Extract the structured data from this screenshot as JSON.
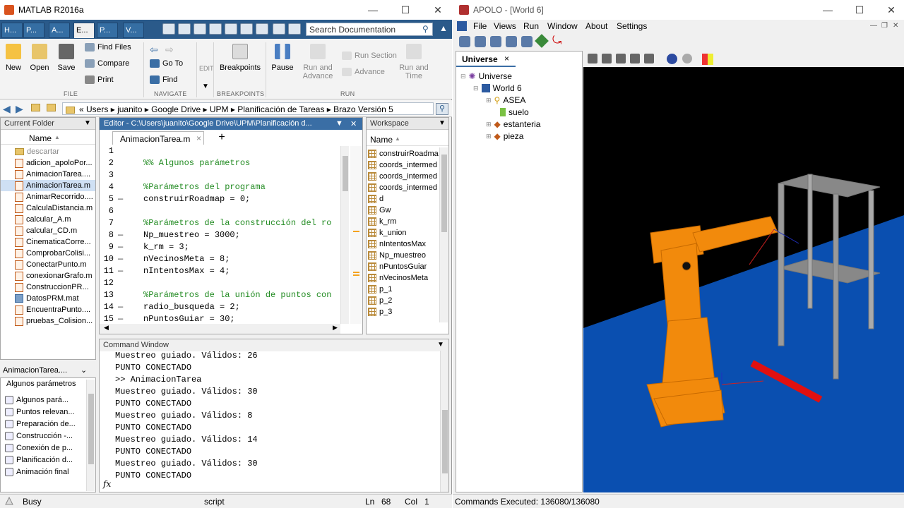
{
  "matlab": {
    "title": "MATLAB R2016a",
    "tabs": [
      "H...",
      "P...",
      "A...",
      "E...",
      "P...",
      "V..."
    ],
    "search_placeholder": "Search Documentation",
    "ribbon": {
      "file": {
        "new": "New",
        "open": "Open",
        "save": "Save",
        "find_files": "Find Files",
        "compare": "Compare",
        "print": "Print",
        "group": "FILE"
      },
      "navigate": {
        "go_to": "Go To",
        "find": "Find",
        "group": "NAVIGATE"
      },
      "edit": {
        "label": "EDIT"
      },
      "breakpoints": {
        "label": "Breakpoints",
        "group": "BREAKPOINTS"
      },
      "run": {
        "pause": "Pause",
        "run_and_advance": "Run and Advance",
        "run_section": "Run Section",
        "advance": "Advance",
        "run_and_time": "Run and Time",
        "group": "RUN"
      }
    },
    "path": [
      "Users",
      "juanito",
      "Google Drive",
      "UPM",
      "Planificación de Tareas",
      "Brazo Versión 5"
    ],
    "current_folder": {
      "title": "Current Folder",
      "col": "Name",
      "items": [
        {
          "name": "descartar",
          "type": "folder"
        },
        {
          "name": "adicion_apoloPor...",
          "type": "m"
        },
        {
          "name": "AnimacionTarea....",
          "type": "m"
        },
        {
          "name": "AnimacionTarea.m",
          "type": "m",
          "selected": true
        },
        {
          "name": "AnimarRecorrido....",
          "type": "m"
        },
        {
          "name": "CalculaDistancia.m",
          "type": "m"
        },
        {
          "name": "calcular_A.m",
          "type": "m"
        },
        {
          "name": "calcular_CD.m",
          "type": "m"
        },
        {
          "name": "CinematicaCorre...",
          "type": "m"
        },
        {
          "name": "ComprobarColisi...",
          "type": "m"
        },
        {
          "name": "ConectarPunto.m",
          "type": "m"
        },
        {
          "name": "conexionarGrafo.m",
          "type": "m"
        },
        {
          "name": "ConstruccionPR...",
          "type": "m"
        },
        {
          "name": "DatosPRM.mat",
          "type": "mat"
        },
        {
          "name": "EncuentraPunto....",
          "type": "m"
        },
        {
          "name": "pruebas_Colision...",
          "type": "m"
        }
      ]
    },
    "details_file": "AnimacionTarea....",
    "outline": {
      "header": "Algunos parámetros",
      "items": [
        "Algunos pará...",
        "Puntos relevan...",
        "Preparación de...",
        "Construcción -...",
        "Conexión de p...",
        "Planificación d...",
        "Animación final"
      ]
    },
    "editor": {
      "title": "Editor - C:\\Users\\juanito\\Google Drive\\UPM\\Planificación d...",
      "tab": "AnimacionTarea.m",
      "lines": [
        {
          "n": "1",
          "dash": "",
          "text": "",
          "cls": ""
        },
        {
          "n": "2",
          "dash": "",
          "text": "%% Algunos parámetros",
          "cls": "cm"
        },
        {
          "n": "3",
          "dash": "",
          "text": "",
          "cls": ""
        },
        {
          "n": "4",
          "dash": "",
          "text": "%Parámetros del programa",
          "cls": "cm"
        },
        {
          "n": "5",
          "dash": "—",
          "text": "construirRoadmap = 0;",
          "cls": ""
        },
        {
          "n": "6",
          "dash": "",
          "text": "",
          "cls": ""
        },
        {
          "n": "7",
          "dash": "",
          "text": "%Parámetros de la construcción del ro",
          "cls": "cm"
        },
        {
          "n": "8",
          "dash": "—",
          "text": "Np_muestreo = 3000;",
          "cls": ""
        },
        {
          "n": "9",
          "dash": "—",
          "text": "k_rm = 3;",
          "cls": ""
        },
        {
          "n": "10",
          "dash": "—",
          "text": "nVecinosMeta = 8;",
          "cls": ""
        },
        {
          "n": "11",
          "dash": "—",
          "text": "nIntentosMax = 4;",
          "cls": ""
        },
        {
          "n": "12",
          "dash": "",
          "text": "",
          "cls": ""
        },
        {
          "n": "13",
          "dash": "",
          "text": "%Parámetros de la unión de puntos con",
          "cls": "cm"
        },
        {
          "n": "14",
          "dash": "—",
          "text": "radio_busqueda = 2;",
          "cls": ""
        },
        {
          "n": "15",
          "dash": "—",
          "text": "nPuntosGuiar = 30;",
          "cls": ""
        }
      ]
    },
    "workspace": {
      "title": "Workspace",
      "col": "Name",
      "items": [
        "construirRoadma",
        "coords_intermed",
        "coords_intermed",
        "coords_intermed",
        "d",
        "Gw",
        "k_rm",
        "k_union",
        "nIntentosMax",
        "Np_muestreo",
        "nPuntosGuiar",
        "nVecinosMeta",
        "p_1",
        "p_2",
        "p_3"
      ]
    },
    "command_window": {
      "title": "Command Window",
      "lines": [
        "Muestreo guiado. Válidos: 26",
        "PUNTO CONECTADO",
        ">> AnimacionTarea",
        "Muestreo guiado. Válidos: 30",
        "PUNTO CONECTADO",
        "Muestreo guiado. Válidos: 8",
        "PUNTO CONECTADO",
        "Muestreo guiado. Válidos: 14",
        "PUNTO CONECTADO",
        "Muestreo guiado. Válidos: 30",
        "PUNTO CONECTADO"
      ],
      "prompt": "fx"
    },
    "status": {
      "state": "Busy",
      "type": "script",
      "ln_label": "Ln",
      "ln": "68",
      "col_label": "Col",
      "col": "1"
    }
  },
  "apolo": {
    "title": "APOLO - [World 6]",
    "menu": [
      "File",
      "Views",
      "Run",
      "Window",
      "About",
      "Settings"
    ],
    "tree_tab": "Universe",
    "tree": [
      "Universe",
      "World 6",
      "ASEA",
      "suelo",
      "estanteria",
      "pieza"
    ],
    "status": "Commands Executed: 136080/136080"
  }
}
